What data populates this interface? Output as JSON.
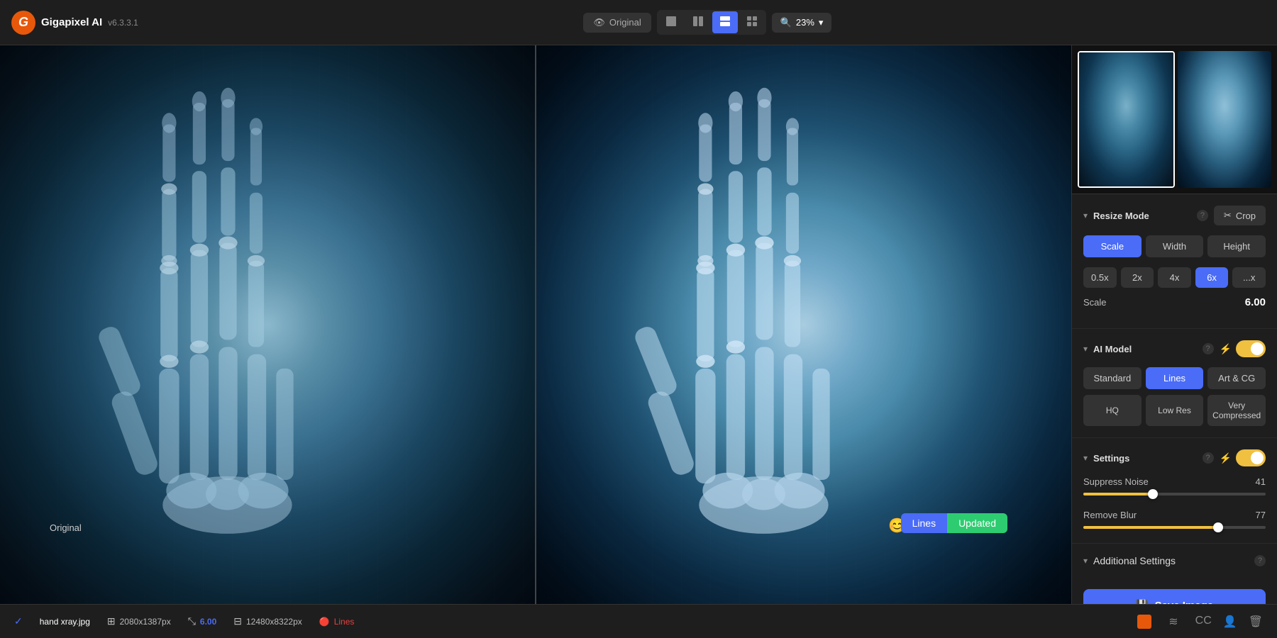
{
  "app": {
    "name": "Gigapixel AI",
    "version": "v6.3.3.1"
  },
  "topbar": {
    "original_label": "Original",
    "zoom_value": "23%",
    "view_buttons": [
      {
        "id": "single",
        "label": "single"
      },
      {
        "id": "split-v",
        "label": "split-v"
      },
      {
        "id": "split-h",
        "label": "split-h",
        "active": true
      },
      {
        "id": "grid",
        "label": "grid"
      }
    ]
  },
  "canvas": {
    "original_label": "Original",
    "model_badge_lines": "Lines",
    "model_badge_updated": "Updated"
  },
  "statusbar": {
    "filename": "hand xray.jpg",
    "original_dims": "2080x1387px",
    "scale": "6.00",
    "output_dims": "12480x8322px",
    "model_label": "Lines",
    "icons": [
      "CC",
      "person",
      "trash"
    ]
  },
  "right_panel": {
    "resize_mode": {
      "title": "Resize Mode",
      "help": "?",
      "crop_label": "Crop",
      "modes": [
        "Scale",
        "Width",
        "Height"
      ],
      "active_mode": "Scale",
      "scale_presets": [
        "0.5x",
        "2x",
        "4x",
        "6x",
        "...x"
      ],
      "active_preset": "6x",
      "scale_label": "Scale",
      "scale_value": "6.00"
    },
    "ai_model": {
      "title": "AI Model",
      "help": "?",
      "toggle_on": true,
      "models": [
        "Standard",
        "Lines",
        "Art & CG"
      ],
      "active_model": "Lines",
      "quality_options": [
        "HQ",
        "Low Res",
        "Very Compressed"
      ]
    },
    "settings": {
      "title": "Settings",
      "help": "?",
      "toggle_on": true,
      "suppress_noise_label": "Suppress Noise",
      "suppress_noise_value": "41",
      "suppress_noise_pct": 38,
      "remove_blur_label": "Remove Blur",
      "remove_blur_value": "77",
      "remove_blur_pct": 74
    },
    "additional_settings": {
      "label": "Additional Settings",
      "help": "?"
    },
    "save_button": "Save Image"
  }
}
